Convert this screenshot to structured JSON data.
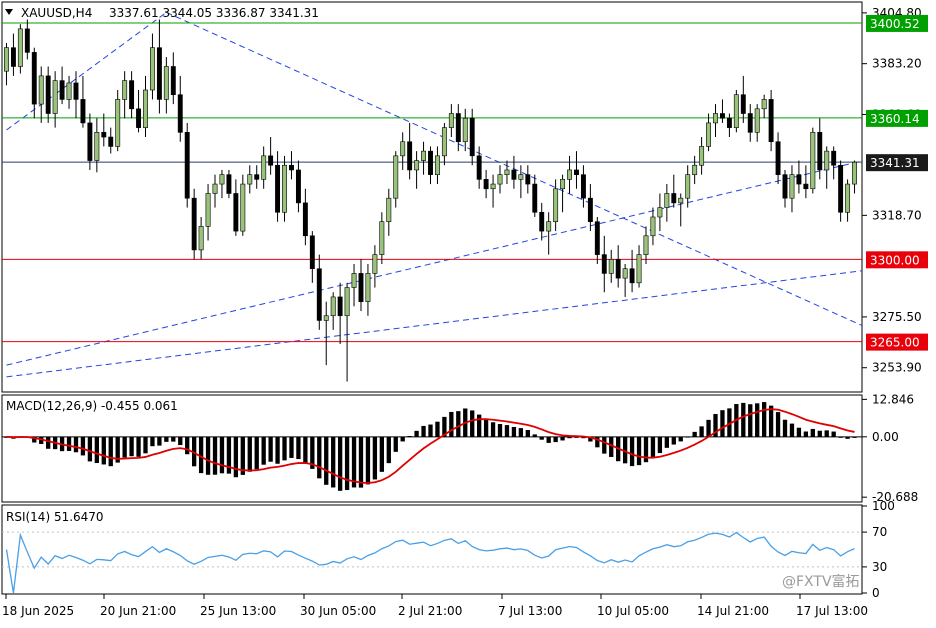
{
  "header": {
    "symbol": "XAUUSD,H4",
    "ohlc": "3337.61 3344.05 3336.87 3341.31"
  },
  "watermark": "@FXTV富拓",
  "colors": {
    "bull": "#99c37a",
    "bear": "#000000",
    "support": "#e8000b",
    "resistance": "#00a000",
    "trend": "#2146e0",
    "current": "#2e3a63",
    "macd_signal": "#e00000",
    "rsi": "#4aa0e6"
  },
  "chart_data": [
    {
      "type": "candlestick",
      "title": "XAUUSD,H4",
      "y_ticks": [
        "3404.80",
        "3383.20",
        "3361.60",
        "3318.70",
        "3275.50",
        "3253.90"
      ],
      "y_range": [
        3244,
        3409
      ],
      "x_labels": [
        "18 Jun 2025",
        "20 Jun 21:00",
        "25 Jun 13:00",
        "30 Jun 05:00",
        "2 Jul 21:00",
        "7 Jul 13:00",
        "10 Jul 05:00",
        "14 Jul 21:00",
        "17 Jul 13:00"
      ],
      "price_levels": [
        {
          "value": 3400.52,
          "label": "3400.52",
          "kind": "resistance"
        },
        {
          "value": 3360.14,
          "label": "3360.14",
          "kind": "resistance"
        },
        {
          "value": 3341.31,
          "label": "3341.31",
          "kind": "current"
        },
        {
          "value": 3300.0,
          "label": "3300.00",
          "kind": "support"
        },
        {
          "value": 3265.0,
          "label": "3265.00",
          "kind": "support"
        }
      ],
      "trendlines": [
        {
          "from": [
            0,
            3355
          ],
          "to": [
            23,
            3405
          ]
        },
        {
          "from": [
            23,
            3405
          ],
          "to": [
            144,
            3244
          ]
        },
        {
          "from": [
            0,
            3255
          ],
          "to": [
            180,
            3382
          ]
        },
        {
          "from": [
            0,
            3250
          ],
          "to": [
            180,
            3316
          ]
        }
      ],
      "candles": [
        [
          3380,
          3392,
          3374,
          3390
        ],
        [
          3390,
          3396,
          3378,
          3382
        ],
        [
          3382,
          3400,
          3379,
          3398
        ],
        [
          3398,
          3402,
          3385,
          3388
        ],
        [
          3388,
          3390,
          3360,
          3366
        ],
        [
          3366,
          3382,
          3358,
          3378
        ],
        [
          3378,
          3382,
          3358,
          3362
        ],
        [
          3362,
          3380,
          3356,
          3376
        ],
        [
          3376,
          3382,
          3366,
          3368
        ],
        [
          3368,
          3378,
          3364,
          3375
        ],
        [
          3375,
          3380,
          3360,
          3368
        ],
        [
          3368,
          3378,
          3356,
          3358
        ],
        [
          3358,
          3362,
          3338,
          3342
        ],
        [
          3342,
          3360,
          3337,
          3354
        ],
        [
          3354,
          3362,
          3348,
          3352
        ],
        [
          3352,
          3356,
          3345,
          3348
        ],
        [
          3348,
          3372,
          3346,
          3368
        ],
        [
          3368,
          3380,
          3360,
          3376
        ],
        [
          3376,
          3380,
          3360,
          3364
        ],
        [
          3364,
          3372,
          3354,
          3356
        ],
        [
          3356,
          3378,
          3352,
          3372
        ],
        [
          3372,
          3396,
          3368,
          3390
        ],
        [
          3390,
          3402,
          3362,
          3368
        ],
        [
          3368,
          3386,
          3362,
          3382
        ],
        [
          3382,
          3388,
          3366,
          3370
        ],
        [
          3370,
          3378,
          3350,
          3354
        ],
        [
          3354,
          3358,
          3322,
          3326
        ],
        [
          3326,
          3330,
          3300,
          3304
        ],
        [
          3304,
          3318,
          3300,
          3314
        ],
        [
          3314,
          3332,
          3308,
          3328
        ],
        [
          3328,
          3336,
          3322,
          3332
        ],
        [
          3332,
          3338,
          3326,
          3336
        ],
        [
          3336,
          3338,
          3326,
          3328
        ],
        [
          3328,
          3334,
          3310,
          3312
        ],
        [
          3312,
          3336,
          3310,
          3332
        ],
        [
          3332,
          3340,
          3328,
          3336
        ],
        [
          3336,
          3340,
          3330,
          3334
        ],
        [
          3334,
          3348,
          3330,
          3344
        ],
        [
          3344,
          3352,
          3336,
          3340
        ],
        [
          3340,
          3346,
          3316,
          3320
        ],
        [
          3320,
          3344,
          3316,
          3340
        ],
        [
          3340,
          3346,
          3334,
          3338
        ],
        [
          3338,
          3342,
          3320,
          3324
        ],
        [
          3324,
          3330,
          3306,
          3310
        ],
        [
          3310,
          3312,
          3290,
          3296
        ],
        [
          3296,
          3302,
          3270,
          3274
        ],
        [
          3274,
          3282,
          3255,
          3276
        ],
        [
          3276,
          3286,
          3270,
          3284
        ],
        [
          3284,
          3290,
          3264,
          3276
        ],
        [
          3276,
          3290,
          3248,
          3288
        ],
        [
          3288,
          3298,
          3280,
          3294
        ],
        [
          3294,
          3300,
          3278,
          3282
        ],
        [
          3282,
          3298,
          3276,
          3294
        ],
        [
          3294,
          3306,
          3288,
          3302
        ],
        [
          3302,
          3320,
          3298,
          3316
        ],
        [
          3316,
          3330,
          3310,
          3326
        ],
        [
          3326,
          3346,
          3322,
          3344
        ],
        [
          3344,
          3354,
          3338,
          3350
        ],
        [
          3350,
          3358,
          3334,
          3338
        ],
        [
          3338,
          3346,
          3330,
          3342
        ],
        [
          3342,
          3350,
          3336,
          3346
        ],
        [
          3346,
          3348,
          3332,
          3336
        ],
        [
          3336,
          3348,
          3332,
          3344
        ],
        [
          3344,
          3358,
          3340,
          3356
        ],
        [
          3356,
          3366,
          3352,
          3362
        ],
        [
          3362,
          3366,
          3346,
          3350
        ],
        [
          3350,
          3364,
          3346,
          3360
        ],
        [
          3360,
          3364,
          3340,
          3344
        ],
        [
          3344,
          3348,
          3330,
          3334
        ],
        [
          3334,
          3338,
          3326,
          3330
        ],
        [
          3330,
          3336,
          3322,
          3332
        ],
        [
          3332,
          3340,
          3328,
          3336
        ],
        [
          3336,
          3342,
          3332,
          3338
        ],
        [
          3338,
          3344,
          3330,
          3334
        ],
        [
          3334,
          3340,
          3326,
          3336
        ],
        [
          3336,
          3340,
          3328,
          3332
        ],
        [
          3332,
          3336,
          3318,
          3320
        ],
        [
          3320,
          3324,
          3308,
          3312
        ],
        [
          3312,
          3320,
          3302,
          3316
        ],
        [
          3316,
          3334,
          3312,
          3330
        ],
        [
          3330,
          3336,
          3320,
          3334
        ],
        [
          3334,
          3344,
          3328,
          3338
        ],
        [
          3338,
          3346,
          3330,
          3336
        ],
        [
          3336,
          3340,
          3322,
          3326
        ],
        [
          3326,
          3332,
          3312,
          3316
        ],
        [
          3316,
          3318,
          3298,
          3302
        ],
        [
          3302,
          3310,
          3286,
          3294
        ],
        [
          3294,
          3304,
          3290,
          3300
        ],
        [
          3300,
          3306,
          3288,
          3292
        ],
        [
          3292,
          3298,
          3284,
          3296
        ],
        [
          3296,
          3304,
          3286,
          3290
        ],
        [
          3290,
          3306,
          3288,
          3302
        ],
        [
          3302,
          3314,
          3298,
          3310
        ],
        [
          3310,
          3322,
          3306,
          3318
        ],
        [
          3318,
          3328,
          3312,
          3322
        ],
        [
          3322,
          3332,
          3316,
          3328
        ],
        [
          3328,
          3336,
          3322,
          3324
        ],
        [
          3324,
          3328,
          3314,
          3326
        ],
        [
          3326,
          3340,
          3322,
          3336
        ],
        [
          3336,
          3344,
          3332,
          3340
        ],
        [
          3340,
          3352,
          3336,
          3348
        ],
        [
          3348,
          3362,
          3346,
          3358
        ],
        [
          3358,
          3366,
          3352,
          3362
        ],
        [
          3362,
          3368,
          3358,
          3360
        ],
        [
          3360,
          3362,
          3352,
          3356
        ],
        [
          3356,
          3372,
          3354,
          3370
        ],
        [
          3370,
          3378,
          3358,
          3362
        ],
        [
          3362,
          3366,
          3350,
          3354
        ],
        [
          3354,
          3366,
          3350,
          3364
        ],
        [
          3364,
          3370,
          3360,
          3368
        ],
        [
          3368,
          3372,
          3346,
          3350
        ],
        [
          3350,
          3354,
          3332,
          3336
        ],
        [
          3336,
          3338,
          3322,
          3326
        ],
        [
          3326,
          3340,
          3320,
          3336
        ],
        [
          3336,
          3342,
          3328,
          3332
        ],
        [
          3332,
          3340,
          3326,
          3330
        ],
        [
          3330,
          3356,
          3328,
          3354
        ],
        [
          3354,
          3360,
          3334,
          3338
        ],
        [
          3338,
          3348,
          3330,
          3346
        ],
        [
          3346,
          3348,
          3334,
          3340
        ],
        [
          3340,
          3342,
          3316,
          3320
        ],
        [
          3320,
          3334,
          3316,
          3332
        ],
        [
          3332,
          3342,
          3328,
          3341.31
        ]
      ]
    },
    {
      "type": "histogram",
      "title": "MACD(12,26,9) -0.455 0.061",
      "y_ticks": [
        "12.846",
        "0.00",
        "-20.688"
      ],
      "y_range": [
        -22,
        14
      ]
    },
    {
      "type": "line",
      "title": "RSI(14) 51.6470",
      "y_ticks": [
        "100",
        "70",
        "30",
        "0"
      ],
      "y_range": [
        0,
        100
      ]
    }
  ]
}
